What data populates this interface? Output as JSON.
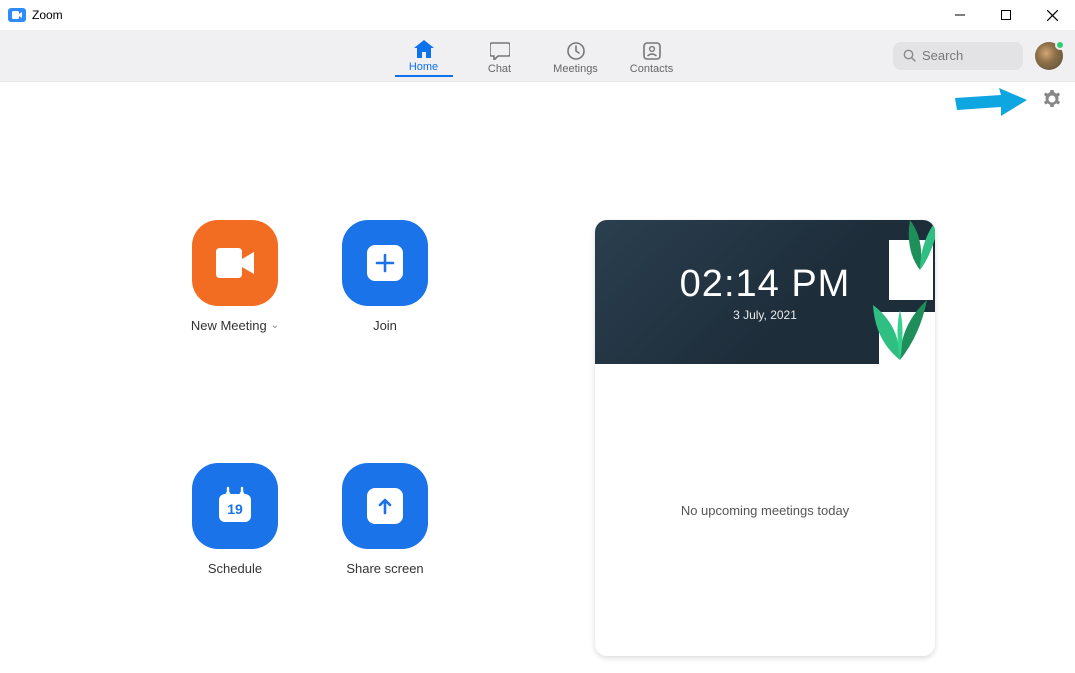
{
  "window": {
    "title": "Zoom"
  },
  "nav": {
    "items": [
      {
        "label": "Home",
        "active": true
      },
      {
        "label": "Chat",
        "active": false
      },
      {
        "label": "Meetings",
        "active": false
      },
      {
        "label": "Contacts",
        "active": false
      }
    ],
    "search_placeholder": "Search"
  },
  "actions": {
    "new_meeting": "New Meeting",
    "join": "Join",
    "schedule": "Schedule",
    "share_screen": "Share screen",
    "schedule_day": "19"
  },
  "panel": {
    "time": "02:14 PM",
    "date": "3 July, 2021",
    "empty_text": "No upcoming meetings today"
  },
  "colors": {
    "accent_blue": "#1a73e8",
    "accent_orange": "#f26d21",
    "zoom_blue": "#0e72ed"
  }
}
